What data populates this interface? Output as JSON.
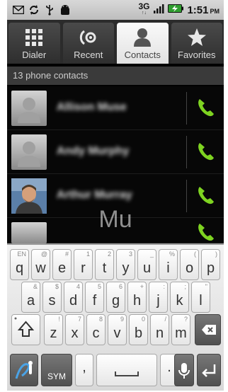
{
  "status_bar": {
    "network": "3G",
    "time": "1:51",
    "ampm": "PM"
  },
  "tabs": [
    {
      "label": "Dialer",
      "icon": "dialpad-icon"
    },
    {
      "label": "Recent",
      "icon": "recent-calls-icon"
    },
    {
      "label": "Contacts",
      "icon": "person-icon"
    },
    {
      "label": "Favorites",
      "icon": "star-icon"
    }
  ],
  "contacts_header": "13 phone contacts",
  "contacts": [
    {
      "name": "Allison Muse"
    },
    {
      "name": "Andy Murphy"
    },
    {
      "name": "Arthur Murray"
    }
  ],
  "fast_scroll_preview": "Mu",
  "keyboard": {
    "row1": [
      {
        "main": "q",
        "sub": "EN"
      },
      {
        "main": "w",
        "sub": "@"
      },
      {
        "main": "e",
        "sub": "#"
      },
      {
        "main": "r",
        "sub": "1"
      },
      {
        "main": "t",
        "sub": "2"
      },
      {
        "main": "y",
        "sub": "3"
      },
      {
        "main": "u",
        "sub": "_"
      },
      {
        "main": "i",
        "sub": "%"
      },
      {
        "main": "o",
        "sub": "("
      },
      {
        "main": "p",
        "sub": ")"
      }
    ],
    "row2": [
      {
        "main": "a",
        "sub": "&"
      },
      {
        "main": "s",
        "sub": "$"
      },
      {
        "main": "d",
        "sub": "4"
      },
      {
        "main": "f",
        "sub": "5"
      },
      {
        "main": "g",
        "sub": "6"
      },
      {
        "main": "h",
        "sub": "+"
      },
      {
        "main": "j",
        "sub": ":"
      },
      {
        "main": "k",
        "sub": ";"
      },
      {
        "main": "l",
        "sub": "\""
      }
    ],
    "row3": [
      {
        "main": "z",
        "sub": "!"
      },
      {
        "main": "x",
        "sub": "7"
      },
      {
        "main": "c",
        "sub": "8"
      },
      {
        "main": "v",
        "sub": "9"
      },
      {
        "main": "b",
        "sub": "0"
      },
      {
        "main": "n",
        "sub": "/"
      },
      {
        "main": "m",
        "sub": "?"
      }
    ],
    "sym_label": "SYM",
    "comma": ",",
    "period": "."
  },
  "colors": {
    "call_green": "#7ed321",
    "tab_active_bg": "#f2f2f2",
    "list_bg": "#070707"
  }
}
